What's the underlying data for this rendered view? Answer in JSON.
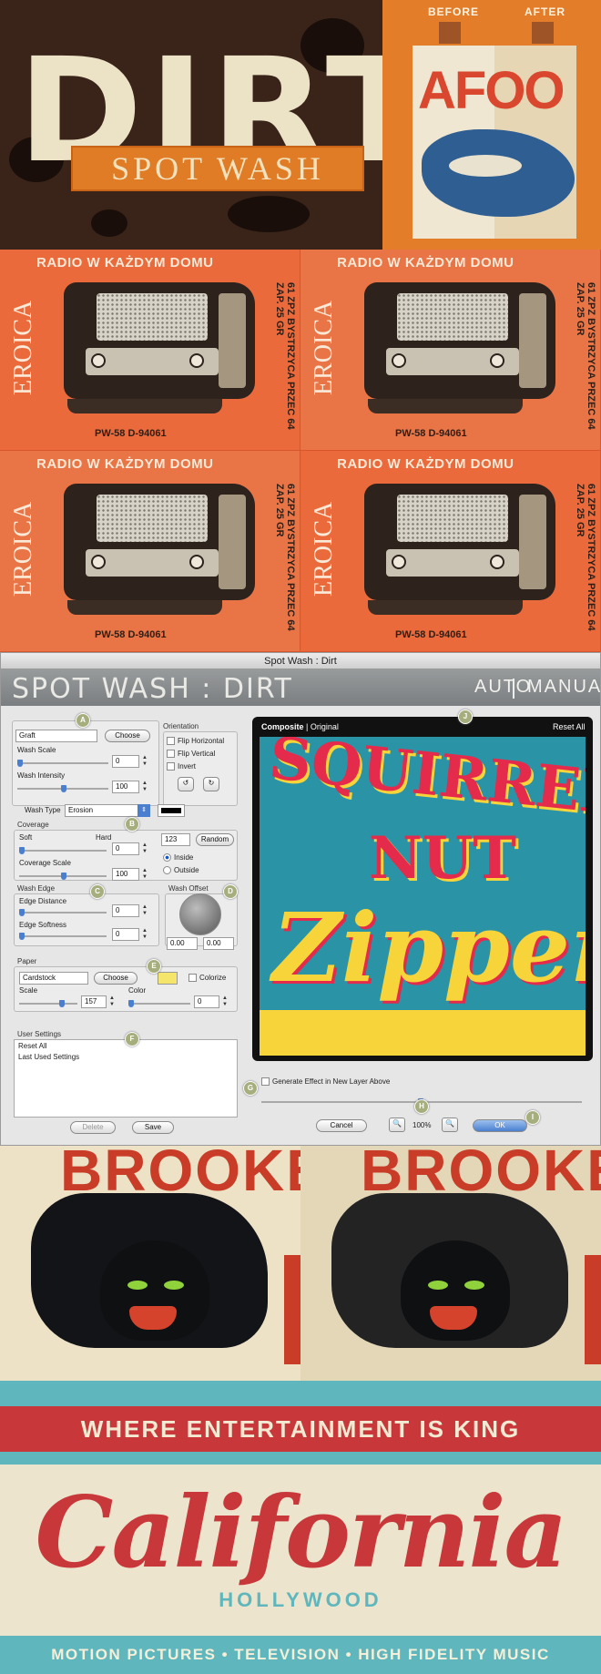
{
  "hero": {
    "dirt_word": "DIRT",
    "spot_wash": "SPOT WASH",
    "before_label": "BEFORE",
    "after_label": "AFTER",
    "sample_word": "AFOO"
  },
  "radios": {
    "cards": [
      {
        "header": "RADIO W KAŻDYM DOMU",
        "brand": "EROICA",
        "side": "61 ZPZ BYSTRZYCA PRZEC 64 ZAP. 25 GR",
        "model": "PW-58 D-94061"
      },
      {
        "header": "RADIO W KAŻDYM DOMU",
        "brand": "EROICA",
        "side": "61 ZPZ BYSTRZYCA PRZEC 64 ZAP. 25 GR",
        "model": "PW-58 D-94061"
      },
      {
        "header": "RADIO W KAŻDYM DOMU",
        "brand": "EROICA",
        "side": "61 ZPZ BYSTRZYCA PRZEC 64 ZAP. 25 GR",
        "model": "PW-58 D-94061"
      },
      {
        "header": "RADIO W KAŻDYM DOMU",
        "brand": "EROICA",
        "side": "61 ZPZ BYSTRZYCA PRZEC 64 ZAP. 25 GR",
        "model": "PW-58 D-94061"
      }
    ]
  },
  "dialog": {
    "window_title": "Spot Wash : Dirt",
    "brand_title": "SPOT WASH : DIRT",
    "mode_auto": "AUTO",
    "mode_manual": "MANUAL",
    "texture_value": "Graft",
    "choose_label": "Choose",
    "wash_scale_label": "Wash Scale",
    "wash_scale_value": "0",
    "wash_intensity_label": "Wash Intensity",
    "wash_intensity_value": "100",
    "orientation_label": "Orientation",
    "flip_horizontal": "Flip Horizontal",
    "flip_vertical": "Flip Vertical",
    "invert": "Invert",
    "wash_type_label": "Wash Type",
    "wash_type_value": "Erosion",
    "coverage_label": "Coverage",
    "soft_label": "Soft",
    "hard_label": "Hard",
    "coverage_soft_value": "0",
    "coverage_seed": "123",
    "random_label": "Random",
    "coverage_scale_label": "Coverage Scale",
    "coverage_scale_value": "100",
    "inside_label": "Inside",
    "outside_label": "Outside",
    "wash_edge_label": "Wash Edge",
    "edge_distance_label": "Edge Distance",
    "edge_distance_value": "0",
    "edge_softness_label": "Edge Softness",
    "edge_softness_value": "0",
    "wash_offset_label": "Wash Offset",
    "offset_x": "0.00",
    "offset_y": "0.00",
    "paper_label": "Paper",
    "paper_value": "Cardstock",
    "paper_choose": "Choose",
    "colorize_label": "Colorize",
    "scale_label": "Scale",
    "scale_value": "157",
    "color_label": "Color",
    "color_value": "0",
    "user_settings_label": "User Settings",
    "settings_items": [
      "Reset All",
      "Last Used Settings"
    ],
    "delete_label": "Delete",
    "save_label": "Save",
    "composite_label": "Composite",
    "original_label": "Original",
    "reset_all_label": "Reset All",
    "generate_label": "Generate Effect in New Layer Above",
    "cancel_label": "Cancel",
    "zoom_value": "100%",
    "ok_label": "OK",
    "callouts": [
      "A",
      "B",
      "C",
      "D",
      "E",
      "F",
      "G",
      "H",
      "I",
      "J"
    ],
    "preview_art": {
      "line1": "SQUIRREL",
      "line2": "NUT",
      "line3": "Zipper"
    },
    "colors": {
      "accent": "#4a7fd0",
      "paper_swatch": "#f5e56b",
      "callout": "#a7ae7e"
    }
  },
  "brooke": {
    "word_left": "BROOKE",
    "word_right": "BROOKE"
  },
  "california": {
    "tagline": "WHERE ENTERTAINMENT IS KING",
    "script": "California",
    "sub": "HOLLYWOOD",
    "footer": "MOTION PICTURES • TELEVISION • HIGH FIDELITY MUSIC"
  }
}
